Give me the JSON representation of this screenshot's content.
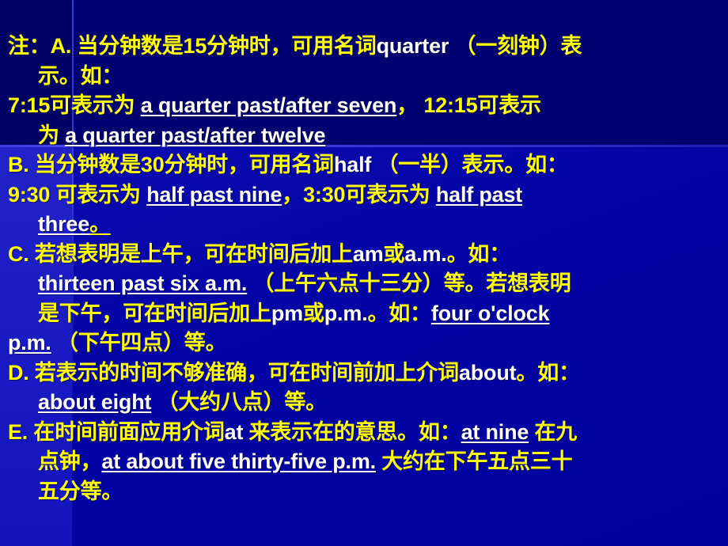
{
  "slide": {
    "kind": "presentation-slide",
    "background_color": "#0000a0",
    "background_dark_color": "#000070",
    "text_color": "#ffff00",
    "highlight_text_color": "#ffffff",
    "lines": [
      {
        "id": "a-1",
        "indent": false,
        "segments": [
          {
            "text": "注：",
            "style": "cn"
          },
          {
            "text": "A.",
            "style": "cn"
          },
          {
            "text": " 当分钟数是",
            "style": "cn"
          },
          {
            "text": "15",
            "style": "cn"
          },
          {
            "text": "分钟时，可用名词",
            "style": "cn"
          },
          {
            "text": "quarter",
            "style": "en"
          },
          {
            "text": " （一刻钟）表",
            "style": "cn"
          }
        ]
      },
      {
        "id": "a-2",
        "indent": true,
        "segments": [
          {
            "text": "示。如：",
            "style": "cn"
          }
        ]
      },
      {
        "id": "a-3",
        "indent": false,
        "segments": [
          {
            "text": "7:15",
            "style": "cn"
          },
          {
            "text": "可表示为 ",
            "style": "cn"
          },
          {
            "text": "a quarter past/after seven",
            "style": "en-underline"
          },
          {
            "text": "，  ",
            "style": "cn"
          },
          {
            "text": "12:15",
            "style": "cn"
          },
          {
            "text": "可表示",
            "style": "cn"
          }
        ]
      },
      {
        "id": "a-4",
        "indent": true,
        "segments": [
          {
            "text": "为 ",
            "style": "cn"
          },
          {
            "text": "a quarter past/after twelve",
            "style": "en-underline"
          }
        ]
      },
      {
        "id": "b-1",
        "indent": false,
        "segments": [
          {
            "text": "B.",
            "style": "cn"
          },
          {
            "text": " 当分钟数是",
            "style": "cn"
          },
          {
            "text": "30",
            "style": "cn"
          },
          {
            "text": "分钟时，可用名词",
            "style": "cn"
          },
          {
            "text": "half",
            "style": "en"
          },
          {
            "text": " （一半）表示。如：",
            "style": "cn"
          }
        ]
      },
      {
        "id": "b-2",
        "indent": false,
        "segments": [
          {
            "text": "9:30",
            "style": "cn"
          },
          {
            "text": " 可表示为 ",
            "style": "cn"
          },
          {
            "text": "half past nine",
            "style": "en-underline"
          },
          {
            "text": "，",
            "style": "cn"
          },
          {
            "text": "3:30",
            "style": "cn"
          },
          {
            "text": "可表示为 ",
            "style": "cn"
          },
          {
            "text": "half past",
            "style": "en-underline"
          }
        ]
      },
      {
        "id": "b-3",
        "indent": true,
        "segments": [
          {
            "text": "three",
            "style": "en-underline"
          },
          {
            "text": "。",
            "style": "cn-underline"
          }
        ]
      },
      {
        "id": "c-1",
        "indent": false,
        "segments": [
          {
            "text": "C.",
            "style": "cn"
          },
          {
            "text": " 若想表明是上午，可在时间后加上",
            "style": "cn"
          },
          {
            "text": "am",
            "style": "en"
          },
          {
            "text": "或",
            "style": "cn"
          },
          {
            "text": "a.m.",
            "style": "en"
          },
          {
            "text": "。如：",
            "style": "cn"
          }
        ]
      },
      {
        "id": "c-2",
        "indent": true,
        "segments": [
          {
            "text": "thirteen past six a.m.",
            "style": "en-underline"
          },
          {
            "text": " （上午六点十三分）等。若想表明",
            "style": "cn"
          }
        ]
      },
      {
        "id": "c-3",
        "indent": true,
        "segments": [
          {
            "text": "是下午，可在时间后加上",
            "style": "cn"
          },
          {
            "text": "pm",
            "style": "en"
          },
          {
            "text": "或",
            "style": "cn"
          },
          {
            "text": "p.m.",
            "style": "en"
          },
          {
            "text": "。如：",
            "style": "cn"
          },
          {
            "text": "four o'clock",
            "style": "en-underline"
          }
        ]
      },
      {
        "id": "c-4",
        "indent": false,
        "segments": [
          {
            "text": "p.m.",
            "style": "en-underline"
          },
          {
            "text": " （下午四点）等。",
            "style": "cn"
          }
        ]
      },
      {
        "id": "d-1",
        "indent": false,
        "segments": [
          {
            "text": "D.",
            "style": "cn"
          },
          {
            "text": " 若表示的时间不够准确，可在时间前加上介词",
            "style": "cn"
          },
          {
            "text": "about",
            "style": "en"
          },
          {
            "text": "。如：",
            "style": "cn"
          }
        ]
      },
      {
        "id": "d-2",
        "indent": true,
        "segments": [
          {
            "text": "about eight",
            "style": "en-underline"
          },
          {
            "text": " （大约八点）等。",
            "style": "cn"
          }
        ]
      },
      {
        "id": "e-1",
        "indent": false,
        "segments": [
          {
            "text": "E.",
            "style": "cn"
          },
          {
            "text": " 在时间前面应用介词",
            "style": "cn"
          },
          {
            "text": "at",
            "style": "en"
          },
          {
            "text": " 来表示在的意思。如：",
            "style": "cn"
          },
          {
            "text": "at nine",
            "style": "en-underline"
          },
          {
            "text": " 在九",
            "style": "cn"
          }
        ]
      },
      {
        "id": "e-2",
        "indent": true,
        "segments": [
          {
            "text": "点钟，",
            "style": "cn"
          },
          {
            "text": "at about five thirty-five p.m.",
            "style": "en-underline"
          },
          {
            "text": " 大约在下午五点三十",
            "style": "cn"
          }
        ]
      },
      {
        "id": "e-3",
        "indent": true,
        "segments": [
          {
            "text": "五分等。",
            "style": "cn"
          }
        ]
      }
    ]
  }
}
